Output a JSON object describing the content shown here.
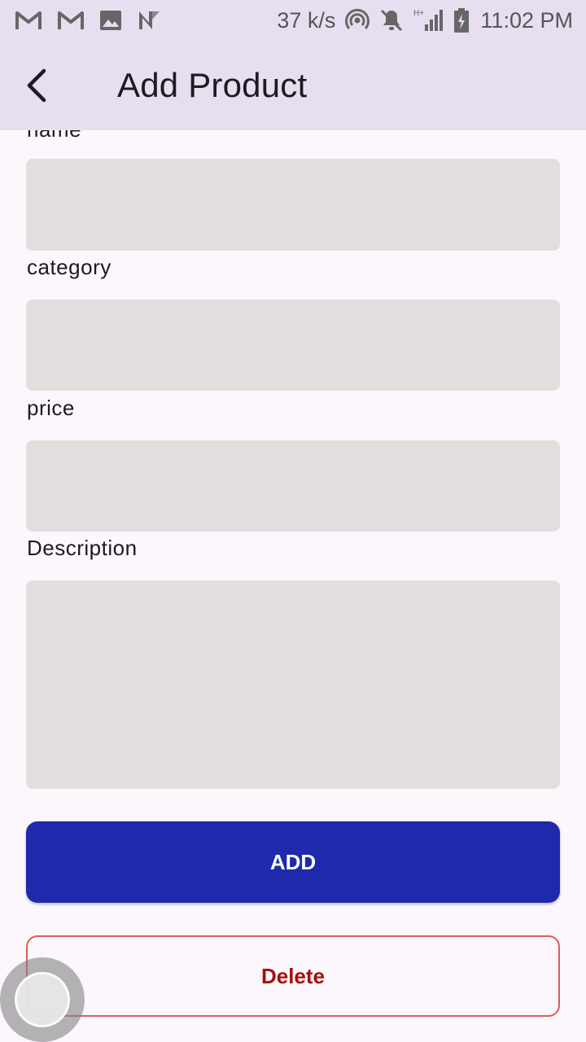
{
  "status_bar": {
    "speed": "37 k/s",
    "time": "11:02 PM",
    "network": "H+"
  },
  "app_bar": {
    "title": "Add Product"
  },
  "form": {
    "name_label": "name",
    "category_label": "category",
    "price_label": "price",
    "description_label": "Description"
  },
  "buttons": {
    "add_label": "ADD",
    "delete_label": "Delete"
  },
  "colors": {
    "app_bar_bg": "#e7def0",
    "field_bg": "#e3dede",
    "add_button": "#1e29ac",
    "delete_text": "#a31010",
    "delete_border": "#e15a5a"
  }
}
